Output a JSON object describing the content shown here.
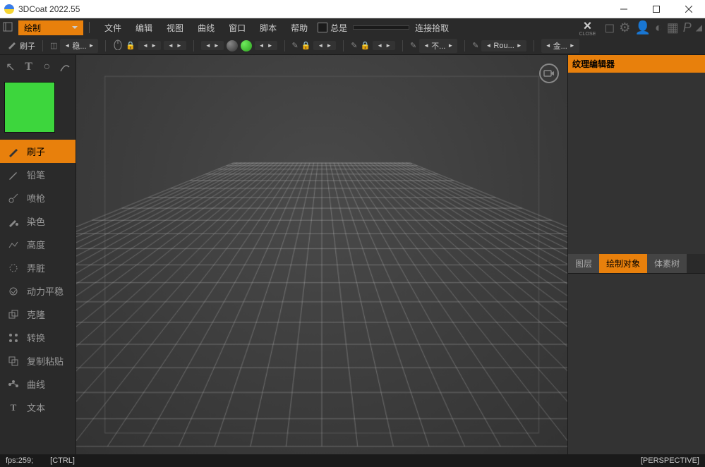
{
  "window": {
    "title": "3DCoat 2022.55"
  },
  "menubar": {
    "mode": "绘制",
    "items": [
      "文件",
      "编辑",
      "视图",
      "曲线",
      "窗口",
      "脚本",
      "帮助"
    ],
    "always": "总是",
    "pickup": "连接拾取",
    "close": "CLOSE"
  },
  "toolbar": {
    "brush": "刷子",
    "steady": "稳...",
    "unknown1": "不...",
    "rou": "Rou...",
    "gold": "金..."
  },
  "tools": {
    "items": [
      {
        "label": "刷子",
        "active": true
      },
      {
        "label": "铅笔",
        "active": false
      },
      {
        "label": "喷枪",
        "active": false
      },
      {
        "label": "染色",
        "active": false
      },
      {
        "label": "高度",
        "active": false
      },
      {
        "label": "弄脏",
        "active": false
      },
      {
        "label": "动力平稳",
        "active": false
      },
      {
        "label": "克隆",
        "active": false
      },
      {
        "label": "转换",
        "active": false
      },
      {
        "label": "复制粘贴",
        "active": false
      },
      {
        "label": "曲线",
        "active": false
      },
      {
        "label": "文本",
        "active": false
      }
    ]
  },
  "color": {
    "current": "#3dd63d"
  },
  "rightPanel": {
    "header_prefix": "纹理编辑",
    "header_bold": "器",
    "tabs": [
      {
        "label": "图层",
        "active": false
      },
      {
        "label": "绘制对象",
        "active": true
      },
      {
        "label": "体素树",
        "active": false
      }
    ]
  },
  "statusbar": {
    "fps": "fps:259;",
    "ctrl": "[CTRL]",
    "perspective": "[PERSPECTIVE]"
  }
}
